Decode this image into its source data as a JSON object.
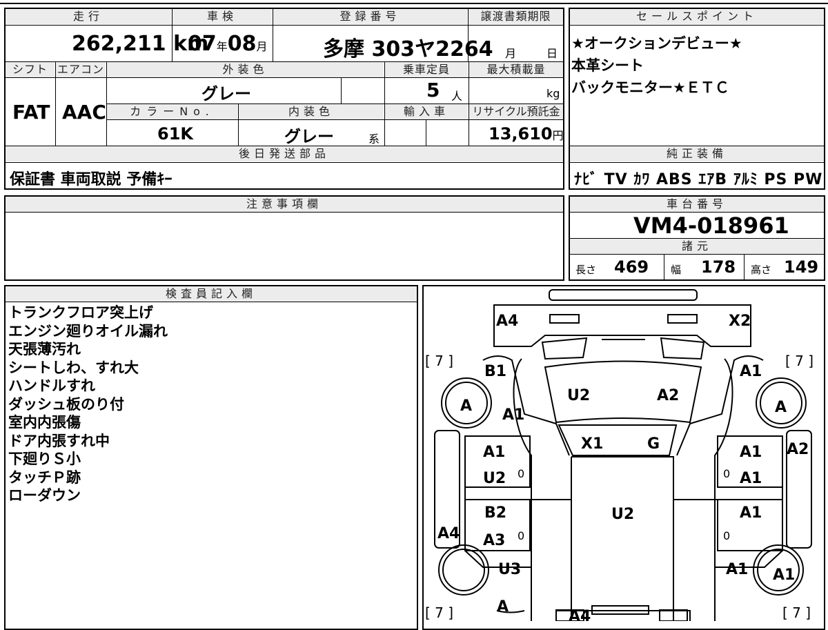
{
  "vehicle": {
    "mileage_label": "走行",
    "mileage": "262,211",
    "mileage_unit": "km",
    "inspection_label": "車検",
    "inspection_year": "07",
    "inspection_year_unit": "年",
    "inspection_month": "08",
    "inspection_month_unit": "月",
    "registration_label": "登録番号",
    "registration_number": "多摩 303ヤ2264",
    "transfer_label": "譲渡書類期限",
    "transfer_month_unit": "月",
    "transfer_day_unit": "日",
    "shift_label": "シフト",
    "shift": "FAT",
    "ac_label": "エアコン",
    "ac": "AAC",
    "exterior_label": "外装色",
    "exterior_color": "グレー",
    "capacity_label": "乗車定員",
    "capacity": "5",
    "capacity_unit": "人",
    "max_load_label": "最大積載量",
    "max_load_unit": "kg",
    "color_no_label": "カラーNo.",
    "color_no": "61K",
    "interior_label": "内装色",
    "interior_color": "グレー",
    "interior_suffix": "系",
    "import_label": "輸入車",
    "recycle_label": "リサイクル預託金",
    "recycle_fee": "13,610",
    "recycle_unit": "円",
    "later_parts_label": "後日発送部品",
    "later_parts": "保証書 車両取説 予備ｷｰ"
  },
  "sales_points": {
    "label": "セールスポイント",
    "lines": [
      "★オークションデビュー★",
      "本革シート",
      "バックモニター★ＥＴＣ"
    ]
  },
  "equipment": {
    "label": "純正装備",
    "items": "ﾅﾋﾞ TV ｶﾜ ABS ｴｱB ｱﾙﾐ PS PW"
  },
  "caution": {
    "label": "注意事項欄"
  },
  "chassis": {
    "label": "車台番号",
    "number": "VM4-018961",
    "specs_label": "諸元",
    "length_label": "長さ",
    "length": "469",
    "width_label": "幅",
    "width": "178",
    "height_label": "高さ",
    "height": "149"
  },
  "inspector": {
    "label": "検査員記入欄",
    "notes": [
      "トランクフロア突上げ",
      "エンジン廻りオイル漏れ",
      "天張薄汚れ",
      "シートしわ、すれ大",
      "ハンドルすれ",
      "ダッシュ板のり付",
      "室内内張傷",
      "ドア内張すれ中",
      "下廻りＳ小",
      "タッチＰ跡",
      "ローダウン"
    ]
  },
  "diagram": {
    "marks": [
      "A4",
      "X2",
      "B1",
      "A1",
      "U2",
      "A2",
      "A1",
      "A",
      "A",
      "A1",
      "X1",
      "G",
      "A1",
      "A2",
      "U2",
      "A1",
      "U2",
      "B2",
      "A1",
      "A1",
      "A4",
      "A3",
      "U3",
      "A1",
      "A",
      "A4",
      "A"
    ],
    "tire_depth": [
      "[ 7 ]",
      "[ 7 ]",
      "[ 7 ]",
      "[ 7 ]"
    ],
    "zeros": [
      "0",
      "0",
      "0",
      "0"
    ]
  }
}
